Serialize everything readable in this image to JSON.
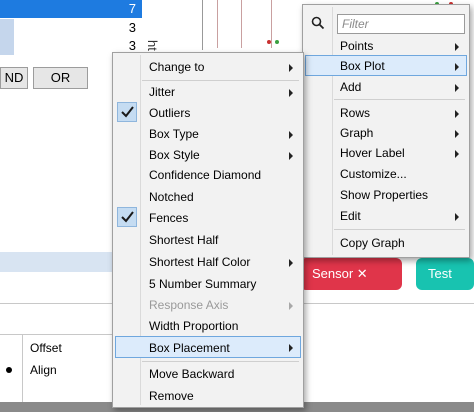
{
  "background": {
    "grid_rows": [
      {
        "value": "7",
        "selected": true
      },
      {
        "value": "3",
        "selected": false
      },
      {
        "value": "3",
        "selected": false
      }
    ],
    "buttons": {
      "and_label": "ND",
      "or_label": "OR"
    },
    "axis_title": "ht",
    "pills": {
      "first_label": "Sensor ✕",
      "second_label": "Test"
    },
    "bottom_rows": [
      {
        "label": "Offset",
        "dot": false
      },
      {
        "label": "Align",
        "dot": true
      }
    ]
  },
  "colors": {
    "selection_blue": "#1e7be0",
    "menu_hover": "#dcebfb",
    "check_bg": "#c5dcf2",
    "pill_red": "#e0354a",
    "pill_teal": "#18c3b0"
  },
  "main_menu": {
    "items": [
      {
        "label": "Change to",
        "submenu": true,
        "checked": false,
        "disabled": false
      },
      {
        "label": "Jitter",
        "submenu": true,
        "checked": false,
        "disabled": false
      },
      {
        "label": "Outliers",
        "submenu": false,
        "checked": true,
        "disabled": false
      },
      {
        "label": "Box Type",
        "submenu": true,
        "checked": false,
        "disabled": false
      },
      {
        "label": "Box Style",
        "submenu": true,
        "checked": false,
        "disabled": false
      },
      {
        "label": "Confidence Diamond",
        "submenu": false,
        "checked": false,
        "disabled": false
      },
      {
        "label": "Notched",
        "submenu": false,
        "checked": false,
        "disabled": false
      },
      {
        "label": "Fences",
        "submenu": false,
        "checked": true,
        "disabled": false
      },
      {
        "label": "Shortest Half",
        "submenu": false,
        "checked": false,
        "disabled": false
      },
      {
        "label": "Shortest Half Color",
        "submenu": true,
        "checked": false,
        "disabled": false
      },
      {
        "label": "5 Number Summary",
        "submenu": false,
        "checked": false,
        "disabled": false
      },
      {
        "label": "Response Axis",
        "submenu": true,
        "checked": false,
        "disabled": true
      },
      {
        "label": "Width Proportion",
        "submenu": false,
        "checked": false,
        "disabled": false
      },
      {
        "label": "Box Placement",
        "submenu": true,
        "checked": false,
        "disabled": false,
        "hover": true
      },
      {
        "label": "Move Backward",
        "submenu": false,
        "checked": false,
        "disabled": false
      },
      {
        "label": "Remove",
        "submenu": false,
        "checked": false,
        "disabled": false
      }
    ]
  },
  "graph_menu": {
    "filter_placeholder": "Filter",
    "items": [
      {
        "label": "Points",
        "submenu": true
      },
      {
        "label": "Box Plot",
        "submenu": true,
        "hover": true
      },
      {
        "label": "Add",
        "submenu": true
      },
      {
        "label": "Rows",
        "submenu": true
      },
      {
        "label": "Graph",
        "submenu": true
      },
      {
        "label": "Hover Label",
        "submenu": true
      },
      {
        "label": "Customize...",
        "submenu": false
      },
      {
        "label": "Show Properties",
        "submenu": false
      },
      {
        "label": "Edit",
        "submenu": true
      },
      {
        "label": "Copy Graph",
        "submenu": false
      }
    ]
  }
}
